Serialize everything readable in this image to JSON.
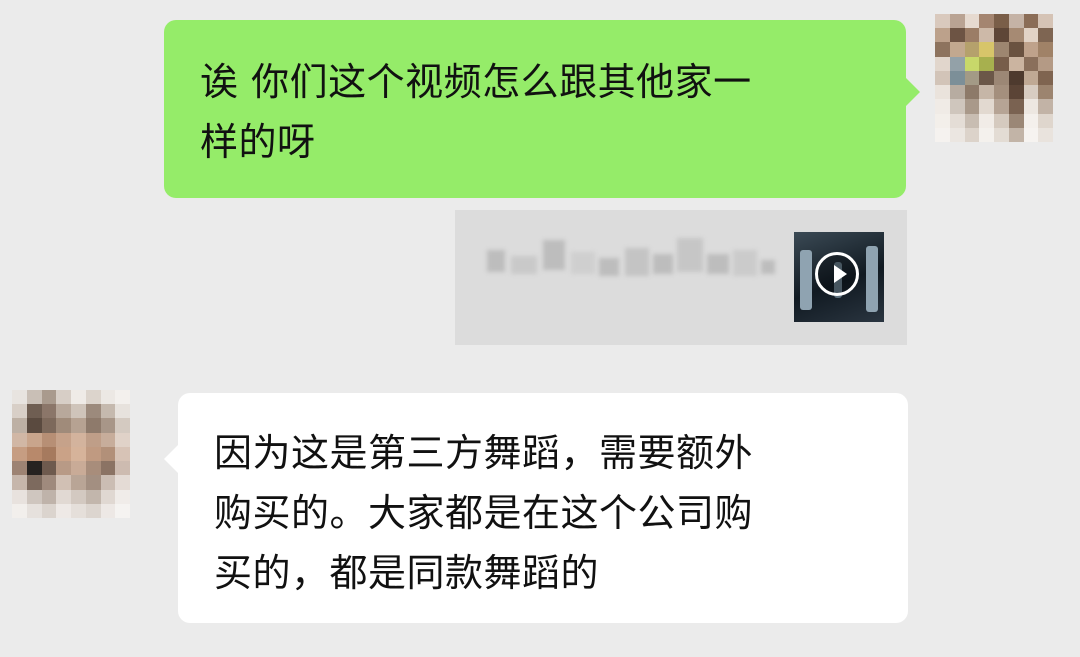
{
  "chat": {
    "messages": [
      {
        "sender": "self",
        "lines": [
          "诶 你们这个视频怎么跟其他家一",
          "样的呀"
        ]
      },
      {
        "sender": "self",
        "type": "video-share",
        "icon": "play-icon"
      },
      {
        "sender": "other",
        "lines": [
          "因为这是第三方舞蹈，需要额外",
          "购买的。大家都是在这个公司购",
          "买的，都是同款舞蹈的"
        ]
      }
    ]
  },
  "colors": {
    "background": "#ebebeb",
    "sent_bubble": "#95ec69",
    "received_bubble": "#ffffff",
    "video_card": "#dcdcdc"
  },
  "avatars": {
    "self": [
      "#d9c9bd",
      "#b9a393",
      "#e6dad0",
      "#a48570",
      "#7a5e48",
      "#c5b3a6",
      "#8b6d57",
      "#d5c3b5",
      "#bca18b",
      "#6d5444",
      "#9b7d66",
      "#cdb9a8",
      "#5e4637",
      "#a68a73",
      "#e2d3c6",
      "#7e6552",
      "#8d735e",
      "#c2a88f",
      "#b5a16c",
      "#d7c56a",
      "#9d8670",
      "#6a5240",
      "#bfa28b",
      "#a08267",
      "#e1d6cc",
      "#93a1a8",
      "#c8d86a",
      "#a7b04e",
      "#775d4a",
      "#cbb4a0",
      "#8a6f5b",
      "#b49a85",
      "#d2c4b8",
      "#7c8f98",
      "#a39a86",
      "#6b5748",
      "#9c8775",
      "#4e3a2e",
      "#c0a994",
      "#7f6450",
      "#eae3dc",
      "#b7aca1",
      "#8d7a69",
      "#c6b6a7",
      "#a48f7d",
      "#5b4436",
      "#d8ccc1",
      "#9c846f",
      "#f0ebe6",
      "#cfc6bd",
      "#a9998a",
      "#e2d9d0",
      "#b6a495",
      "#7a6251",
      "#ede7e1",
      "#c2b3a6",
      "#f3efea",
      "#e4ddd6",
      "#c8bdb2",
      "#f1ece7",
      "#d5cabf",
      "#9b8776",
      "#f4f0ec",
      "#dfd6cd",
      "#f5f2ef",
      "#ebe6e1",
      "#dcd3ca",
      "#f4f1ed",
      "#e3dcd4",
      "#c2b4a7",
      "#f6f3f0",
      "#e9e3dd"
    ],
    "other": [
      "#e8e4e0",
      "#c9bfb6",
      "#a99a8d",
      "#d7cec6",
      "#efebe7",
      "#dcd4cc",
      "#ece8e4",
      "#f3f0ed",
      "#d8cfc7",
      "#6f5e52",
      "#8b7669",
      "#b8a89b",
      "#cfc4ba",
      "#9c8a7c",
      "#c5b9ae",
      "#e7e2dd",
      "#bdb0a4",
      "#5a4a3f",
      "#7d695b",
      "#a08b7a",
      "#b6a292",
      "#8e7a6b",
      "#a89688",
      "#d4cac1",
      "#d1b7a5",
      "#c9a58c",
      "#b78f75",
      "#c6a28a",
      "#d3b39d",
      "#bf9e88",
      "#c7ad9b",
      "#e0d2c8",
      "#c69d82",
      "#b8896b",
      "#a67a5e",
      "#caa287",
      "#d6b39a",
      "#c09a81",
      "#b29079",
      "#d7c3b6",
      "#9d8373",
      "#262220",
      "#6e5a4e",
      "#b89a86",
      "#c9ab97",
      "#a88d7b",
      "#8b7364",
      "#cdbbb0",
      "#c6b6ab",
      "#7d6a5e",
      "#9f8a7d",
      "#d1c0b4",
      "#b9a596",
      "#a38f81",
      "#cbbdb3",
      "#e4dbd5",
      "#e8e2de",
      "#cfc6bf",
      "#bfb3aa",
      "#e1d9d3",
      "#d3c9c1",
      "#c2b6ac",
      "#e0d8d2",
      "#f0ece9",
      "#f2efec",
      "#e6e1dd",
      "#dbd4ce",
      "#eee9e6",
      "#e5dfda",
      "#dcd5cf",
      "#ede8e5",
      "#f5f3f1"
    ]
  }
}
